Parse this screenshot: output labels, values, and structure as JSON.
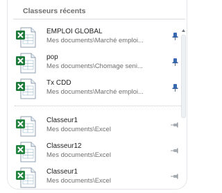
{
  "header": {
    "title": "Classeurs récents"
  },
  "pinned_docs": [
    {
      "name": "EMPLOI GLOBAL",
      "path": "Mes documents\\Marché emploi...",
      "icon": "excel-file-icon",
      "pin": "pinned-pin-icon"
    },
    {
      "name": "pop",
      "path": "Mes documents\\Chomage seni...",
      "icon": "excel-file-icon",
      "pin": "pinned-pin-icon"
    },
    {
      "name": "Tx CDD",
      "path": "Mes documents\\Marché emploi...",
      "icon": "excel-file-icon",
      "pin": "pinned-pin-icon"
    }
  ],
  "recent_docs": [
    {
      "name": "Classeur1",
      "path": "Mes documents\\Excel",
      "icon": "excel-workbook-icon",
      "pin": "unpinned-pin-icon"
    },
    {
      "name": "Classeur12",
      "path": "Mes documents\\Excel",
      "icon": "excel-workbook-icon",
      "pin": "unpinned-pin-icon"
    },
    {
      "name": "Classeur1",
      "path": "Mes documents\\Excel",
      "icon": "excel-workbook-icon",
      "pin": "unpinned-pin-icon"
    }
  ],
  "colors": {
    "excel_green": "#1d7a3a",
    "pin_blue": "#3a6ab0",
    "pin_gray": "#a8adb3"
  }
}
